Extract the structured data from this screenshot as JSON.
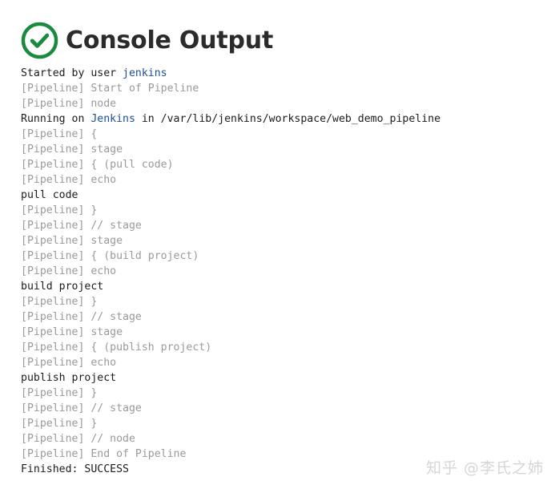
{
  "header": {
    "title": "Console Output",
    "status_icon": "success-check-icon",
    "status_color": "#1a8a3e"
  },
  "colors": {
    "text": "#1c1c1c",
    "pipeline_text": "#9a9a9a",
    "link": "#1f4f8f",
    "title": "#2b2b2b"
  },
  "console": {
    "lines": [
      {
        "type": "plain",
        "parts": [
          {
            "text": "Started by user "
          },
          {
            "text": "jenkins",
            "link": true
          }
        ]
      },
      {
        "type": "pipeline",
        "parts": [
          {
            "text": "[Pipeline] Start of Pipeline"
          }
        ]
      },
      {
        "type": "pipeline",
        "parts": [
          {
            "text": "[Pipeline] node"
          }
        ]
      },
      {
        "type": "plain",
        "parts": [
          {
            "text": "Running on "
          },
          {
            "text": "Jenkins",
            "link": true
          },
          {
            "text": " in /var/lib/jenkins/workspace/web_demo_pipeline"
          }
        ]
      },
      {
        "type": "pipeline",
        "parts": [
          {
            "text": "[Pipeline] {"
          }
        ]
      },
      {
        "type": "pipeline",
        "parts": [
          {
            "text": "[Pipeline] stage"
          }
        ]
      },
      {
        "type": "pipeline",
        "parts": [
          {
            "text": "[Pipeline] { (pull code)"
          }
        ]
      },
      {
        "type": "pipeline",
        "parts": [
          {
            "text": "[Pipeline] echo"
          }
        ]
      },
      {
        "type": "plain",
        "parts": [
          {
            "text": "pull code"
          }
        ]
      },
      {
        "type": "pipeline",
        "parts": [
          {
            "text": "[Pipeline] }"
          }
        ]
      },
      {
        "type": "pipeline",
        "parts": [
          {
            "text": "[Pipeline] // stage"
          }
        ]
      },
      {
        "type": "pipeline",
        "parts": [
          {
            "text": "[Pipeline] stage"
          }
        ]
      },
      {
        "type": "pipeline",
        "parts": [
          {
            "text": "[Pipeline] { (build project)"
          }
        ]
      },
      {
        "type": "pipeline",
        "parts": [
          {
            "text": "[Pipeline] echo"
          }
        ]
      },
      {
        "type": "plain",
        "parts": [
          {
            "text": "build project"
          }
        ]
      },
      {
        "type": "pipeline",
        "parts": [
          {
            "text": "[Pipeline] }"
          }
        ]
      },
      {
        "type": "pipeline",
        "parts": [
          {
            "text": "[Pipeline] // stage"
          }
        ]
      },
      {
        "type": "pipeline",
        "parts": [
          {
            "text": "[Pipeline] stage"
          }
        ]
      },
      {
        "type": "pipeline",
        "parts": [
          {
            "text": "[Pipeline] { (publish project)"
          }
        ]
      },
      {
        "type": "pipeline",
        "parts": [
          {
            "text": "[Pipeline] echo"
          }
        ]
      },
      {
        "type": "plain",
        "parts": [
          {
            "text": "publish project"
          }
        ]
      },
      {
        "type": "pipeline",
        "parts": [
          {
            "text": "[Pipeline] }"
          }
        ]
      },
      {
        "type": "pipeline",
        "parts": [
          {
            "text": "[Pipeline] // stage"
          }
        ]
      },
      {
        "type": "pipeline",
        "parts": [
          {
            "text": "[Pipeline] }"
          }
        ]
      },
      {
        "type": "pipeline",
        "parts": [
          {
            "text": "[Pipeline] // node"
          }
        ]
      },
      {
        "type": "pipeline",
        "parts": [
          {
            "text": "[Pipeline] End of Pipeline"
          }
        ]
      },
      {
        "type": "plain",
        "parts": [
          {
            "text": "Finished: SUCCESS"
          }
        ]
      }
    ]
  },
  "watermark": {
    "text": "知乎 @李氏之姉"
  }
}
